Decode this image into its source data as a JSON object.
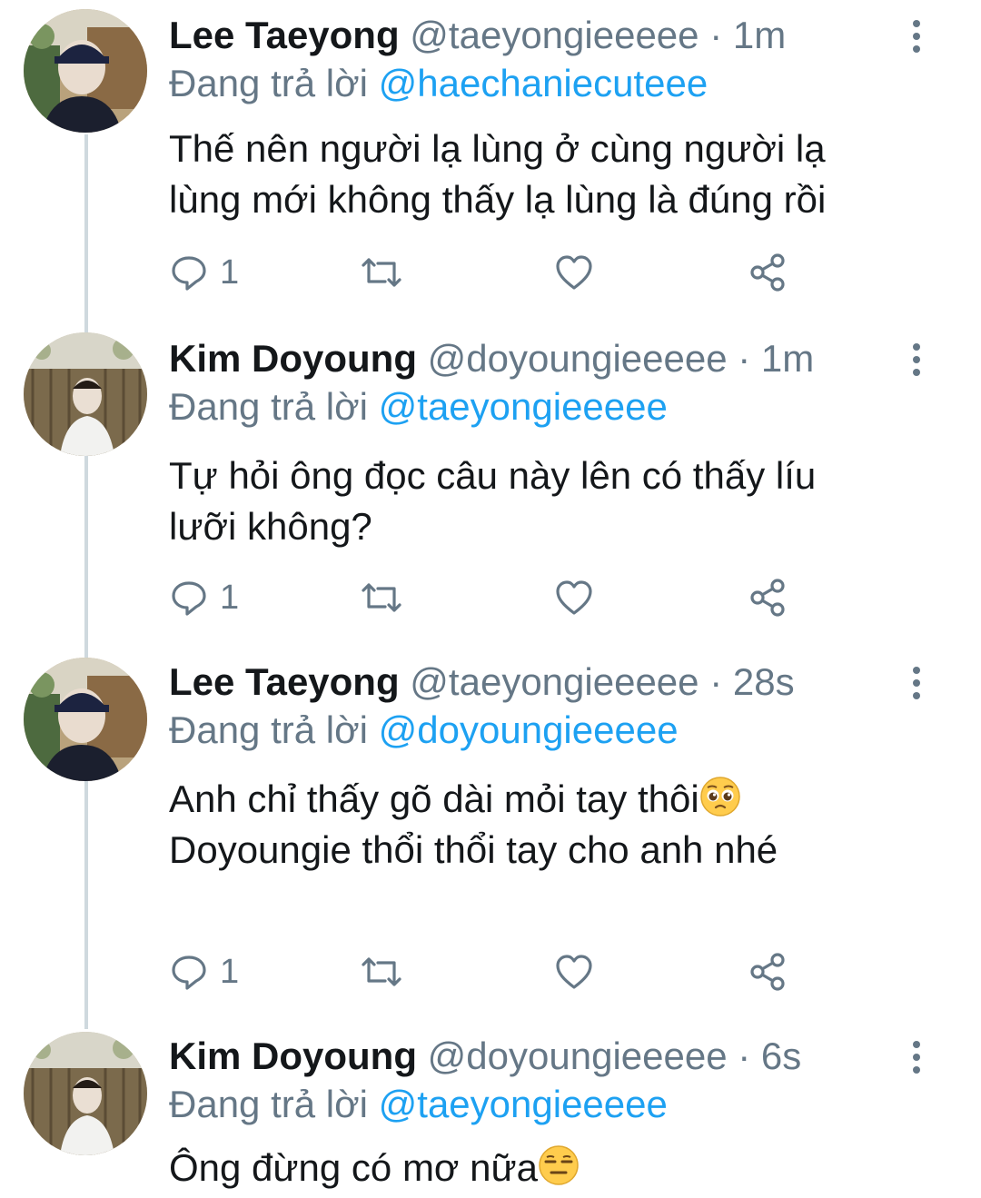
{
  "tweets": [
    {
      "name": "Lee Taeyong",
      "handle": "@taeyongieeeee",
      "time": "1m",
      "reply_prefix": "Đang trả lời",
      "reply_to": "@haechaniecuteee",
      "lines": [
        "Thế nên người lạ lùng ở cùng người lạ",
        "lùng mới không thấy lạ lùng là đúng rồi"
      ],
      "reply_count": "1",
      "avatar": "avatar-taeyong"
    },
    {
      "name": "Kim Doyoung",
      "handle": "@doyoungieeeee",
      "time": "1m",
      "reply_prefix": "Đang trả lời",
      "reply_to": "@taeyongieeeee",
      "lines": [
        "Tự hỏi ông đọc câu này lên có thấy líu",
        "lưỡi không?"
      ],
      "reply_count": "1",
      "avatar": "avatar-doyoung"
    },
    {
      "name": "Lee Taeyong",
      "handle": "@taeyongieeeee",
      "time": "28s",
      "reply_prefix": "Đang trả lời",
      "reply_to": "@doyoungieeeee",
      "lines": [
        "Anh chỉ thấy gõ dài mỏi tay thôi",
        "Doyoungie thổi thổi tay cho anh nhé"
      ],
      "line_emoji": [
        "pleading-face-emoji",
        ""
      ],
      "reply_count": "1",
      "avatar": "avatar-taeyong"
    },
    {
      "name": "Kim Doyoung",
      "handle": "@doyoungieeeee",
      "time": "6s",
      "reply_prefix": "Đang trả lời",
      "reply_to": "@taeyongieeeee",
      "lines": [
        "Ông đừng có mơ nữa"
      ],
      "line_emoji": [
        "expressionless-face-emoji"
      ],
      "avatar": "avatar-doyoung"
    }
  ],
  "separator": "·",
  "icons": {
    "reply": "reply-icon",
    "retweet": "retweet-icon",
    "like": "heart-icon",
    "share": "share-icon",
    "more": "more-vertical-icon"
  },
  "colors": {
    "accent": "#1da1f2",
    "secondary_text": "#657786",
    "primary_text": "#14171a",
    "thread_line": "#cfd9de"
  }
}
